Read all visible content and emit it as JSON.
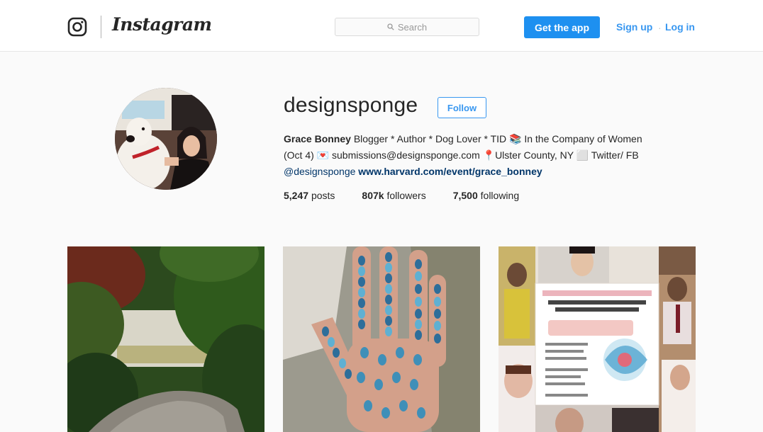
{
  "header": {
    "brand": "Instagram",
    "search_placeholder": "Search",
    "get_app_label": "Get the app",
    "signup_label": "Sign up",
    "separator": "·",
    "login_label": "Log in"
  },
  "profile": {
    "username": "designsponge",
    "follow_label": "Follow",
    "full_name": "Grace Bonney",
    "bio_line1": " Blogger * Author * Dog Lover * TID 📚 In the Company of Women",
    "bio_line2": "(Oct 4) 💌 submissions@designsponge.com 📍Ulster County, NY ⬜ Twitter/ FB",
    "bio_handle": "@designsponge",
    "website": "www.harvard.com/event/grace_bonney"
  },
  "stats": [
    {
      "value": "5,247",
      "label": "posts"
    },
    {
      "value": "807k",
      "label": "followers"
    },
    {
      "value": "7,500",
      "label": "following"
    }
  ],
  "posts": [
    {
      "subject": "forest-overlook-photo"
    },
    {
      "subject": "painted-hand-photo"
    },
    {
      "subject": "book-tour-collage-photo"
    }
  ],
  "colors": {
    "accent": "#3897f0",
    "button_blue": "#1e90f0",
    "text": "#262626",
    "link": "#003569",
    "background": "#fafafa"
  },
  "icons": {
    "logo": "instagram-camera-icon",
    "search": "search-icon"
  }
}
